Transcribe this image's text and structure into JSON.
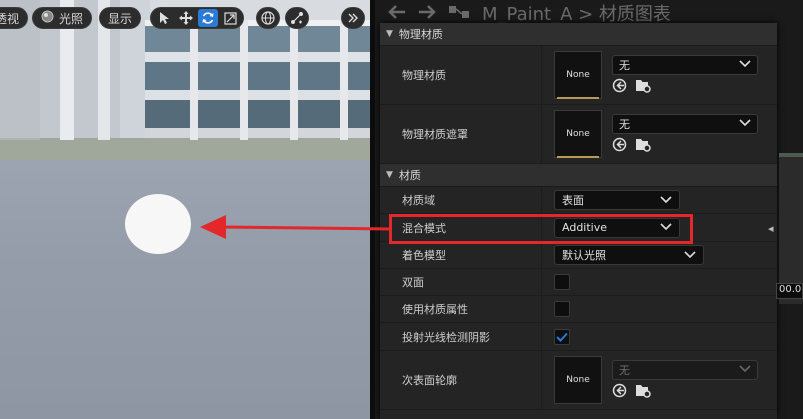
{
  "viewport": {
    "toolbar": {
      "view_label": "透视",
      "lit_label": "光照",
      "show_label": "显示",
      "transform_tools": [
        "select-icon",
        "move-icon",
        "rotate-icon",
        "scale-icon"
      ],
      "world_icon": "globe-icon",
      "snap_icon": "snap-icon",
      "overflow_icon": "double-chevron-right-icon"
    }
  },
  "editor_header": {
    "title": "M_Paint_A > 材质图表"
  },
  "details": {
    "physical_category": "物理材质",
    "physical_material": {
      "label": "物理材质",
      "thumb": "None",
      "value": "无"
    },
    "physical_mask": {
      "label": "物理材质遮罩",
      "thumb": "None",
      "value": "无"
    },
    "material_category": "材质",
    "material_domain": {
      "label": "材质域",
      "value": "表面"
    },
    "blend_mode": {
      "label": "混合模式",
      "value": "Additive"
    },
    "shading_model": {
      "label": "着色模型",
      "value": "默认光照"
    },
    "two_sided": {
      "label": "双面",
      "checked": false
    },
    "use_material_attributes": {
      "label": "使用材质属性",
      "checked": false
    },
    "cast_ray_traced_shadows": {
      "label": "投射光线检测阴影",
      "checked": true
    },
    "subsurface_profile": {
      "label": "次表面轮廓",
      "thumb": "None",
      "value": "无"
    }
  },
  "graph_node": {
    "value": "00.0"
  },
  "colors": {
    "highlight": "#e3272a",
    "accent": "#2a7bd6",
    "thumb_underline": "#b79a5a"
  }
}
